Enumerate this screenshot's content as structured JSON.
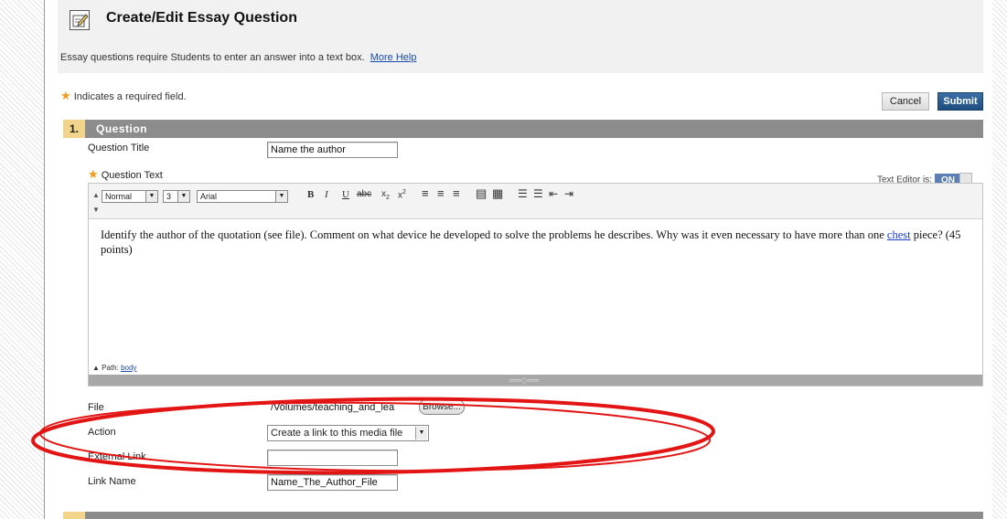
{
  "page": {
    "title": "Create/Edit Essay Question",
    "instructions": "Essay questions require Students to enter an answer into a text box.",
    "more_help": "More Help",
    "required_note": "Indicates a required field."
  },
  "buttons": {
    "cancel": "Cancel",
    "submit": "Submit"
  },
  "section": {
    "number": "1.",
    "title": "Question"
  },
  "fields": {
    "question_title_label": "Question Title",
    "question_title_value": "Name the author",
    "question_text_label": "Question Text",
    "file_label": "File",
    "file_value": "/Volumes/teaching_and_lea",
    "browse": "Browse...",
    "action_label": "Action",
    "action_value": "Create a link to this media file",
    "external_link_label": "External Link",
    "external_link_value": "",
    "link_name_label": "Link Name",
    "link_name_value": "Name_The_Author_File"
  },
  "text_editor": {
    "label": "Text Editor is:",
    "state": "ON",
    "format": "Normal",
    "size": "3",
    "font": "Arial",
    "path_label": "Path:",
    "path_value": "body",
    "content_before": "Identify the author of the quotation (see file).  Comment on what device he developed to solve the problems he describes. Why was it even necessary to have more than one ",
    "content_link": "chest",
    "content_after": " piece?  (45 points)"
  },
  "icons": [
    "edit-question-icon",
    "required-star-icon",
    "bold-icon",
    "italic-icon",
    "underline-icon",
    "strikethrough-icon",
    "subscript-icon",
    "superscript-icon",
    "align-left-icon",
    "align-center-icon",
    "align-right-icon",
    "insert-image-icon",
    "insert-table-icon",
    "numbered-list-icon",
    "bulleted-list-icon",
    "outdent-icon",
    "indent-icon"
  ],
  "colors": {
    "submit": "#1f4d80",
    "section_bar": "#8c8c8c",
    "section_number": "#f2d58a",
    "required_star": "#f39a17",
    "annotation": "#e31414"
  }
}
